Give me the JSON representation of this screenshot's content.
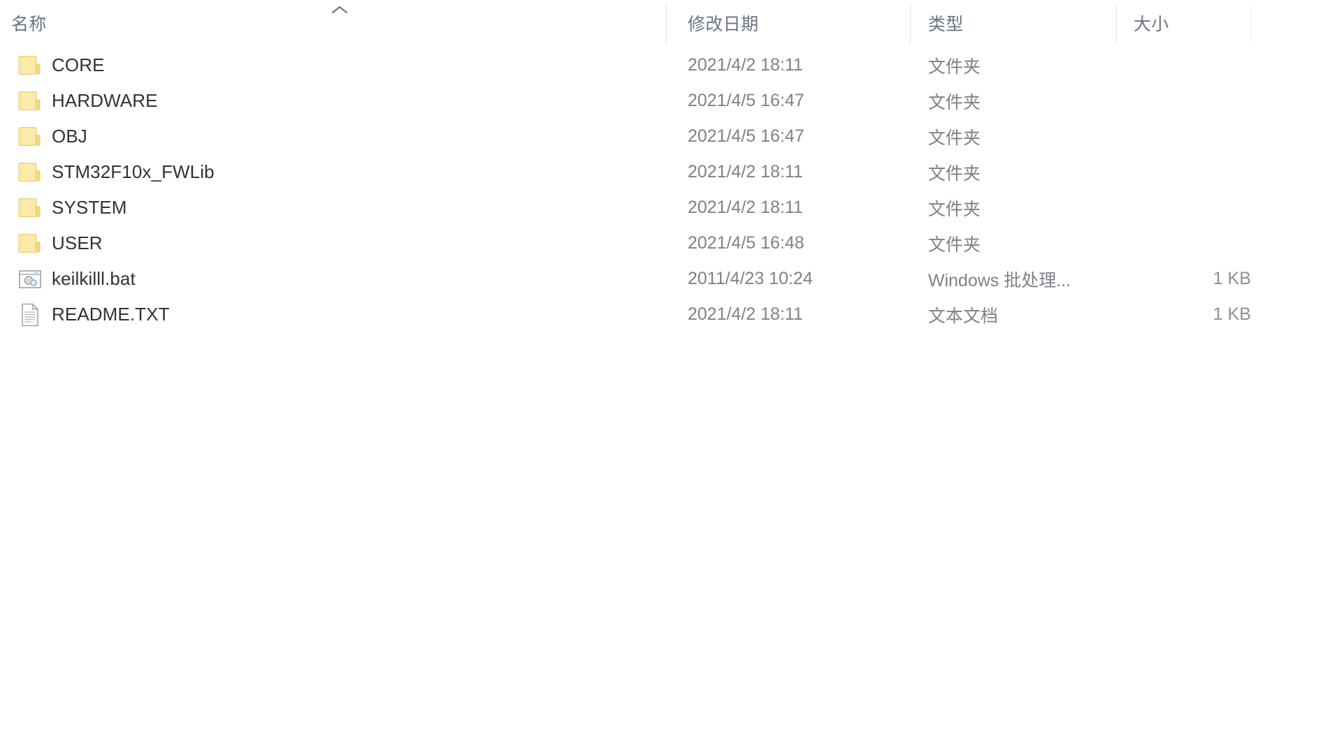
{
  "columns": {
    "name": "名称",
    "date_modified": "修改日期",
    "type": "类型",
    "size": "大小",
    "sort_indicator": "chevron-up-icon",
    "sorted_by": "名称",
    "sort_direction": "ascending"
  },
  "colors": {
    "folder_fill": "#f7e18f",
    "folder_tab": "#f0d574",
    "header_text": "#6b7480",
    "name_text": "#2f3337",
    "meta_text": "#7d8288",
    "divider": "#e3e5e8",
    "background": "#ffffff",
    "doc_icon": "#9a9a9a",
    "bat_icon": "#8d9196"
  },
  "files": [
    {
      "name": "CORE",
      "icon": "folder-icon",
      "date_modified": "2021/4/2 18:11",
      "type": "文件夹",
      "size": ""
    },
    {
      "name": "HARDWARE",
      "icon": "folder-icon",
      "date_modified": "2021/4/5 16:47",
      "type": "文件夹",
      "size": ""
    },
    {
      "name": "OBJ",
      "icon": "folder-icon",
      "date_modified": "2021/4/5 16:47",
      "type": "文件夹",
      "size": ""
    },
    {
      "name": "STM32F10x_FWLib",
      "icon": "folder-icon",
      "date_modified": "2021/4/2 18:11",
      "type": "文件夹",
      "size": ""
    },
    {
      "name": "SYSTEM",
      "icon": "folder-icon",
      "date_modified": "2021/4/2 18:11",
      "type": "文件夹",
      "size": ""
    },
    {
      "name": "USER",
      "icon": "folder-icon",
      "date_modified": "2021/4/5 16:48",
      "type": "文件夹",
      "size": ""
    },
    {
      "name": "keilkilll.bat",
      "icon": "batch-file-icon",
      "date_modified": "2011/4/23 10:24",
      "type": "Windows 批处理...",
      "size": "1 KB"
    },
    {
      "name": "README.TXT",
      "icon": "text-document-icon",
      "date_modified": "2021/4/2 18:11",
      "type": "文本文档",
      "size": "1 KB"
    }
  ]
}
